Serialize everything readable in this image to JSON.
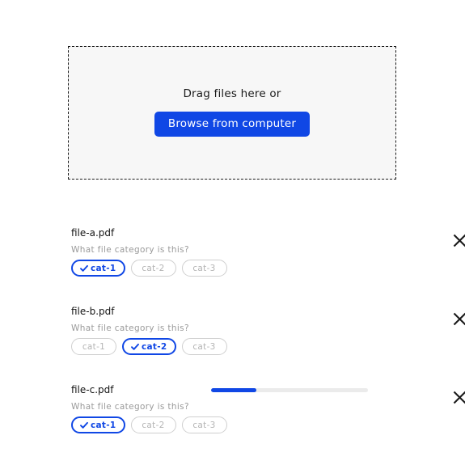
{
  "colors": {
    "accent": "#1047e5",
    "dropzone_bg": "#f7f7f7",
    "dropzone_border": "#1a1a1a",
    "muted_text": "#9a9a9a",
    "chip_border": "#cfcfcf",
    "chip_text": "#b4b4b4",
    "progress_track": "#ebebeb",
    "page_bg": "#ffffff",
    "close_icon": "#1a1a1a"
  },
  "dropzone": {
    "prompt": "Drag files here or",
    "browse_label": "Browse from computer",
    "browse_icon": "upload-icon"
  },
  "files": [
    {
      "name": "file-a.pdf",
      "question": "What file category is this?",
      "remove_icon": "close-icon",
      "has_progress": false,
      "progress_percent": 0,
      "options": [
        {
          "label": "cat-1",
          "selected": true,
          "check_icon": "check-icon"
        },
        {
          "label": "cat-2",
          "selected": false,
          "check_icon": "check-icon"
        },
        {
          "label": "cat-3",
          "selected": false,
          "check_icon": "check-icon"
        }
      ]
    },
    {
      "name": "file-b.pdf",
      "question": "What file category is this?",
      "remove_icon": "close-icon",
      "has_progress": false,
      "progress_percent": 0,
      "options": [
        {
          "label": "cat-1",
          "selected": false,
          "check_icon": "check-icon"
        },
        {
          "label": "cat-2",
          "selected": true,
          "check_icon": "check-icon"
        },
        {
          "label": "cat-3",
          "selected": false,
          "check_icon": "check-icon"
        }
      ]
    },
    {
      "name": "file-c.pdf",
      "question": "What file category is this?",
      "remove_icon": "close-icon",
      "has_progress": true,
      "progress_percent": 29,
      "options": [
        {
          "label": "cat-1",
          "selected": true,
          "check_icon": "check-icon"
        },
        {
          "label": "cat-2",
          "selected": false,
          "check_icon": "check-icon"
        },
        {
          "label": "cat-3",
          "selected": false,
          "check_icon": "check-icon"
        }
      ]
    }
  ]
}
